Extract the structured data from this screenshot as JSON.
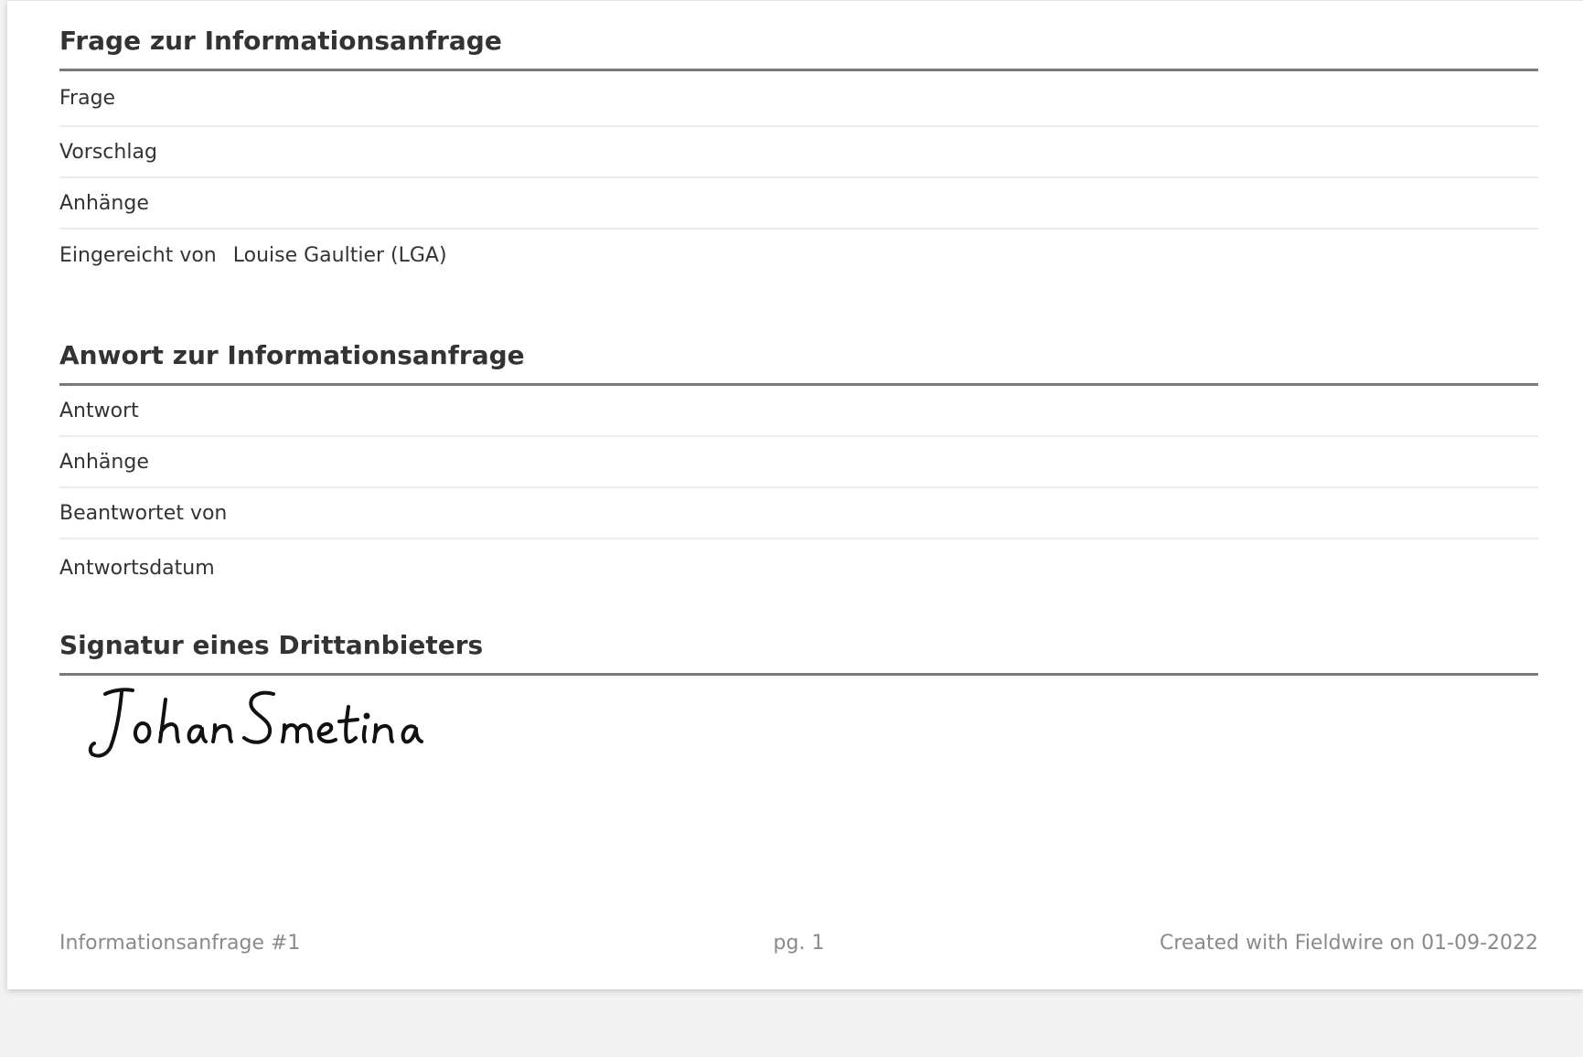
{
  "question_section": {
    "title": "Frage zur Informationsanfrage",
    "fields": {
      "question_label": "Frage",
      "proposal_label": "Vorschlag",
      "attachments_label": "Anhänge",
      "submitted_by_label": "Eingereicht von",
      "submitted_by_value": "Louise Gaultier (LGA)"
    }
  },
  "answer_section": {
    "title": "Anwort zur Informationsanfrage",
    "fields": {
      "answer_label": "Antwort",
      "attachments_label": "Anhänge",
      "answered_by_label": "Beantwortet von",
      "answer_date_label": "Antwortsdatum"
    }
  },
  "signature_section": {
    "title": "Signatur eines Drittanbieters",
    "signature_name": "Johan Smetina"
  },
  "footer": {
    "document_ref": "Informationsanfrage #1",
    "page": "pg. 1",
    "created": "Created with Fieldwire on 01-09-2022"
  }
}
